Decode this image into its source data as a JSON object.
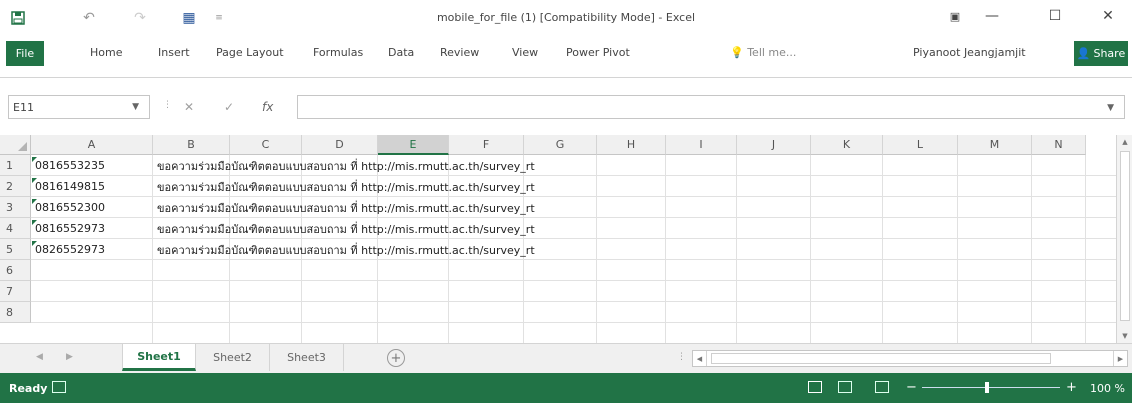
{
  "window": {
    "title": "mobile_for_file (1)  [Compatibility Mode] - Excel",
    "accent_color": "#217346"
  },
  "ribbon": {
    "file_label": "File",
    "tabs": [
      "Home",
      "Insert",
      "Page Layout",
      "Formulas",
      "Data",
      "Review",
      "View",
      "Power Pivot"
    ],
    "tell_me": "Tell me...",
    "user_name": "Piyanoot Jeangjamjit",
    "share_label": "Share"
  },
  "formula_bar": {
    "name_box": "E11",
    "fx_label": "fx",
    "value": ""
  },
  "grid": {
    "selected_column": "E",
    "columns": [
      "A",
      "B",
      "C",
      "D",
      "E",
      "F",
      "G",
      "H",
      "I",
      "J",
      "K",
      "L",
      "M",
      "N"
    ],
    "row_numbers": [
      "1",
      "2",
      "3",
      "4",
      "5",
      "6",
      "7",
      "8"
    ],
    "rows": [
      {
        "a": "0816553235",
        "b": "ขอความร่วมมือบัณฑิตตอบแบบสอบถาม ที่ http://mis.rmutt.ac.th/survey_rt"
      },
      {
        "a": "0816149815",
        "b": "ขอความร่วมมือบัณฑิตตอบแบบสอบถาม ที่ http://mis.rmutt.ac.th/survey_rt"
      },
      {
        "a": "0816552300",
        "b": "ขอความร่วมมือบัณฑิตตอบแบบสอบถาม ที่ http://mis.rmutt.ac.th/survey_rt"
      },
      {
        "a": "0816552973",
        "b": "ขอความร่วมมือบัณฑิตตอบแบบสอบถาม ที่ http://mis.rmutt.ac.th/survey_rt"
      },
      {
        "a": "0826552973",
        "b": "ขอความร่วมมือบัณฑิตตอบแบบสอบถาม ที่ http://mis.rmutt.ac.th/survey_rt"
      }
    ]
  },
  "sheets": {
    "tabs": [
      "Sheet1",
      "Sheet2",
      "Sheet3"
    ],
    "active": "Sheet1"
  },
  "status": {
    "ready": "Ready",
    "zoom": "100 %"
  }
}
